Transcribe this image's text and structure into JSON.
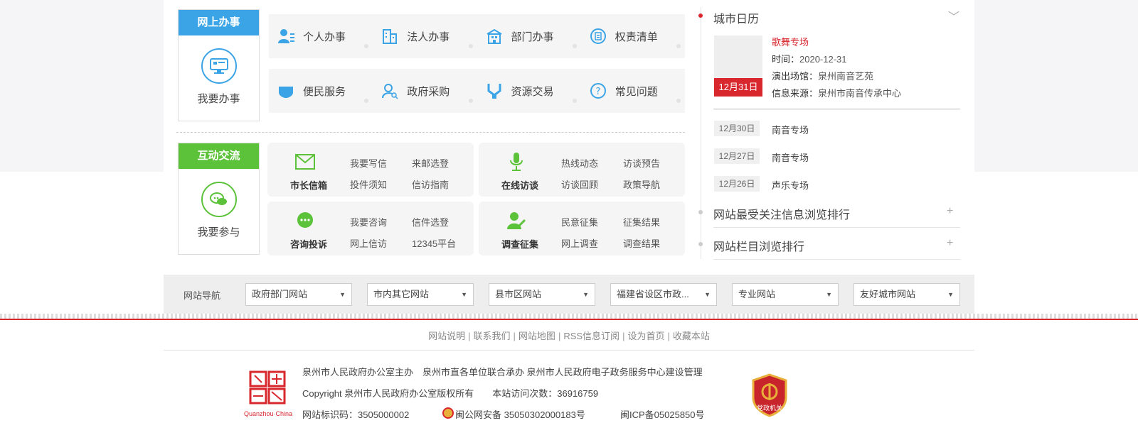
{
  "online": {
    "header": "网上办事",
    "label": "我要办事",
    "accent": "#3aa4e6",
    "row1": [
      "个人办事",
      "法人办事",
      "部门办事",
      "权责清单"
    ],
    "row2": [
      "便民服务",
      "政府采购",
      "资源交易",
      "常见问题"
    ]
  },
  "interact": {
    "header": "互动交流",
    "label": "我要参与",
    "accent": "#5cc23a",
    "cards": [
      {
        "title": "市长信箱",
        "links": [
          "我要写信",
          "来邮选登",
          "投件须知",
          "信访指南"
        ]
      },
      {
        "title": "在线访谈",
        "links": [
          "热线动态",
          "访谈预告",
          "访谈回顾",
          "政策导航"
        ]
      },
      {
        "title": "咨询投诉",
        "links": [
          "我要咨询",
          "信件选登",
          "网上信访",
          "12345平台"
        ]
      },
      {
        "title": "调查征集",
        "links": [
          "民意征集",
          "征集结果",
          "网上调查",
          "调查结果"
        ]
      }
    ]
  },
  "calendar": {
    "title": "城市日历",
    "featured": {
      "date": "12月31日",
      "title": "歌舞专场",
      "time_label": "时间：",
      "time": "2020-12-31",
      "venue_label": "演出场馆：",
      "venue": "泉州南音艺苑",
      "source_label": "信息来源：",
      "source": "泉州市南音传承中心"
    },
    "events": [
      {
        "date": "12月30日",
        "name": "南音专场"
      },
      {
        "date": "12月27日",
        "name": "南音专场"
      },
      {
        "date": "12月26日",
        "name": "声乐专场"
      }
    ],
    "rank1": "网站最受关注信息浏览排行",
    "rank2": "网站栏目浏览排行"
  },
  "nav": {
    "label": "网站导航",
    "selects": [
      "政府部门网站",
      "市内其它网站",
      "县市区网站",
      "福建省设区市政...",
      "专业网站",
      "友好城市网站"
    ]
  },
  "footer": {
    "links": [
      "网站说明",
      "联系我们",
      "网站地图",
      "RSS信息订阅",
      "设为首页",
      "收藏本站"
    ],
    "line1": "泉州市人民政府办公室主办　泉州市直各单位联合承办 泉州市人民政府电子政务服务中心建设管理",
    "line2": "Copyright 泉州市人民政府办公室版权所有　　本站访问次数：36916759",
    "line3a": "网站标识码：3505000002",
    "line3b": "闽公网安备 35050302000183号",
    "line3c": "闽ICP备05025850号",
    "logo_text": "Quanzhou·China",
    "badge_text": "党政机关"
  },
  "colors": {
    "red": "#d9272e",
    "blue": "#3aa4e6",
    "green": "#5cc23a"
  }
}
